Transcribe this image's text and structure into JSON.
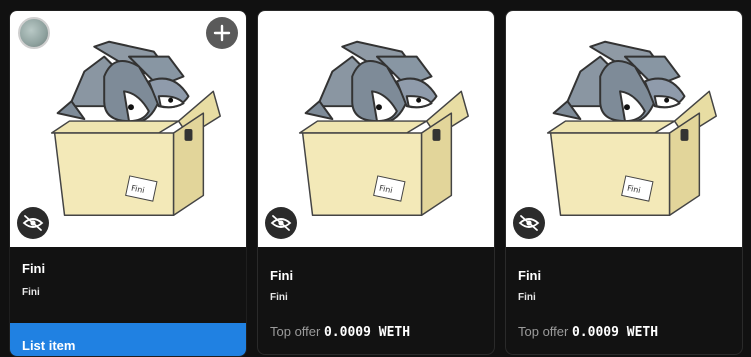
{
  "cards": [
    {
      "title": "Fini",
      "collection": "Fini",
      "action_label": "List item"
    },
    {
      "title": "Fini",
      "collection": "Fini",
      "offer_label": "Top offer",
      "offer_value": "0.0009 WETH"
    },
    {
      "title": "Fini",
      "collection": "Fini",
      "offer_label": "Top offer",
      "offer_value": "0.0009 WETH"
    }
  ],
  "colors": {
    "background": "#111111",
    "card": "#121212",
    "accent": "#2081e2",
    "muted_text": "#9b9b9b"
  },
  "icons": {
    "hide": "eye-slash-icon",
    "add": "plus-icon"
  }
}
